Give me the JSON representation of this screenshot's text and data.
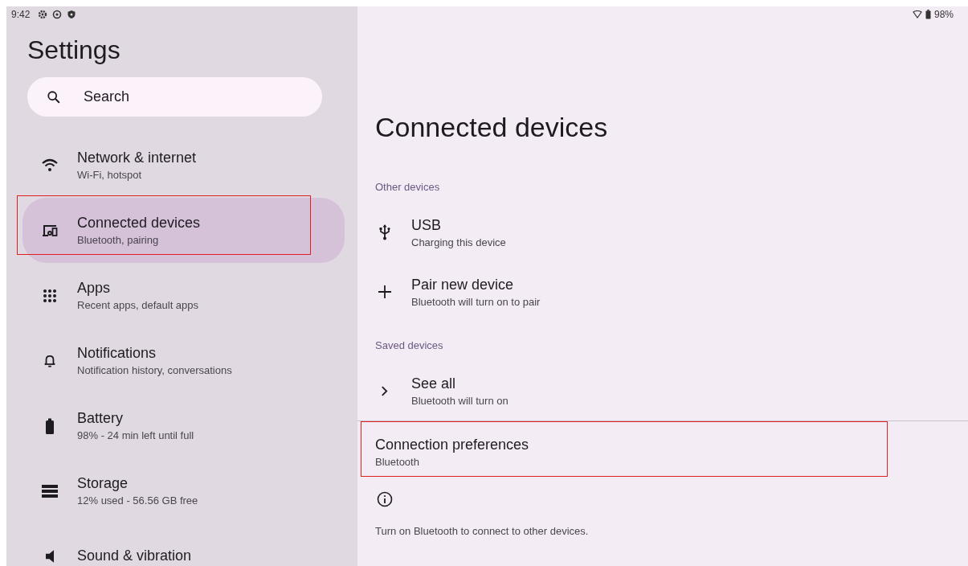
{
  "status_bar": {
    "time": "9:42",
    "battery": "98%"
  },
  "sidebar": {
    "title": "Settings",
    "search": {
      "placeholder": "Search"
    },
    "items": [
      {
        "title": "Network & internet",
        "subtitle": "Wi-Fi, hotspot",
        "selected": false,
        "highlighted": false
      },
      {
        "title": "Connected devices",
        "subtitle": "Bluetooth, pairing",
        "selected": true,
        "highlighted": true
      },
      {
        "title": "Apps",
        "subtitle": "Recent apps, default apps",
        "selected": false,
        "highlighted": false
      },
      {
        "title": "Notifications",
        "subtitle": "Notification history, conversations",
        "selected": false,
        "highlighted": false
      },
      {
        "title": "Battery",
        "subtitle": "98% - 24 min left until full",
        "selected": false,
        "highlighted": false
      },
      {
        "title": "Storage",
        "subtitle": "12% used - 56.56 GB free",
        "selected": false,
        "highlighted": false
      },
      {
        "title": "Sound & vibration",
        "selected": false,
        "highlighted": false
      }
    ]
  },
  "page": {
    "title": "Connected devices",
    "rows": [
      {
        "kind": "section",
        "title": "Other devices"
      },
      {
        "kind": "item",
        "title": "USB",
        "subtitle": "Charging this device"
      },
      {
        "kind": "item",
        "title": "Pair new device",
        "subtitle": "Bluetooth will turn on to pair"
      },
      {
        "kind": "section",
        "title": "Saved devices"
      },
      {
        "kind": "item",
        "title": "See all",
        "subtitle": "Bluetooth will turn on"
      },
      {
        "kind": "divider"
      },
      {
        "kind": "pref",
        "title": "Connection preferences",
        "subtitle": "Bluetooth",
        "highlighted": true
      },
      {
        "kind": "footer",
        "title": "Turn on Bluetooth to connect to other devices."
      }
    ]
  }
}
